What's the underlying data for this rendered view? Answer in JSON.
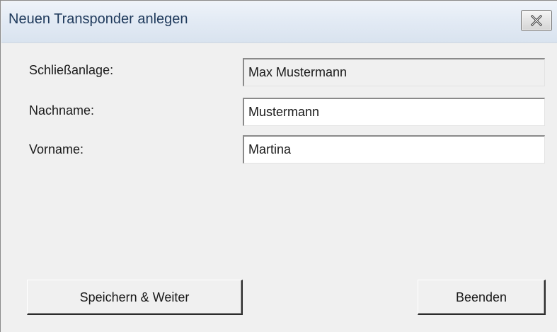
{
  "window": {
    "title": "Neuen Transponder anlegen"
  },
  "form": {
    "fields": [
      {
        "label": "Schließanlage:",
        "value": "Max Mustermann",
        "readonly": true
      },
      {
        "label": "Nachname:",
        "value": "Mustermann",
        "readonly": false
      },
      {
        "label": "Vorname:",
        "value": "Martina",
        "readonly": false
      }
    ]
  },
  "buttons": {
    "save_next": "Speichern & Weiter",
    "quit": "Beenden"
  },
  "icons": {
    "close": "close-icon"
  }
}
